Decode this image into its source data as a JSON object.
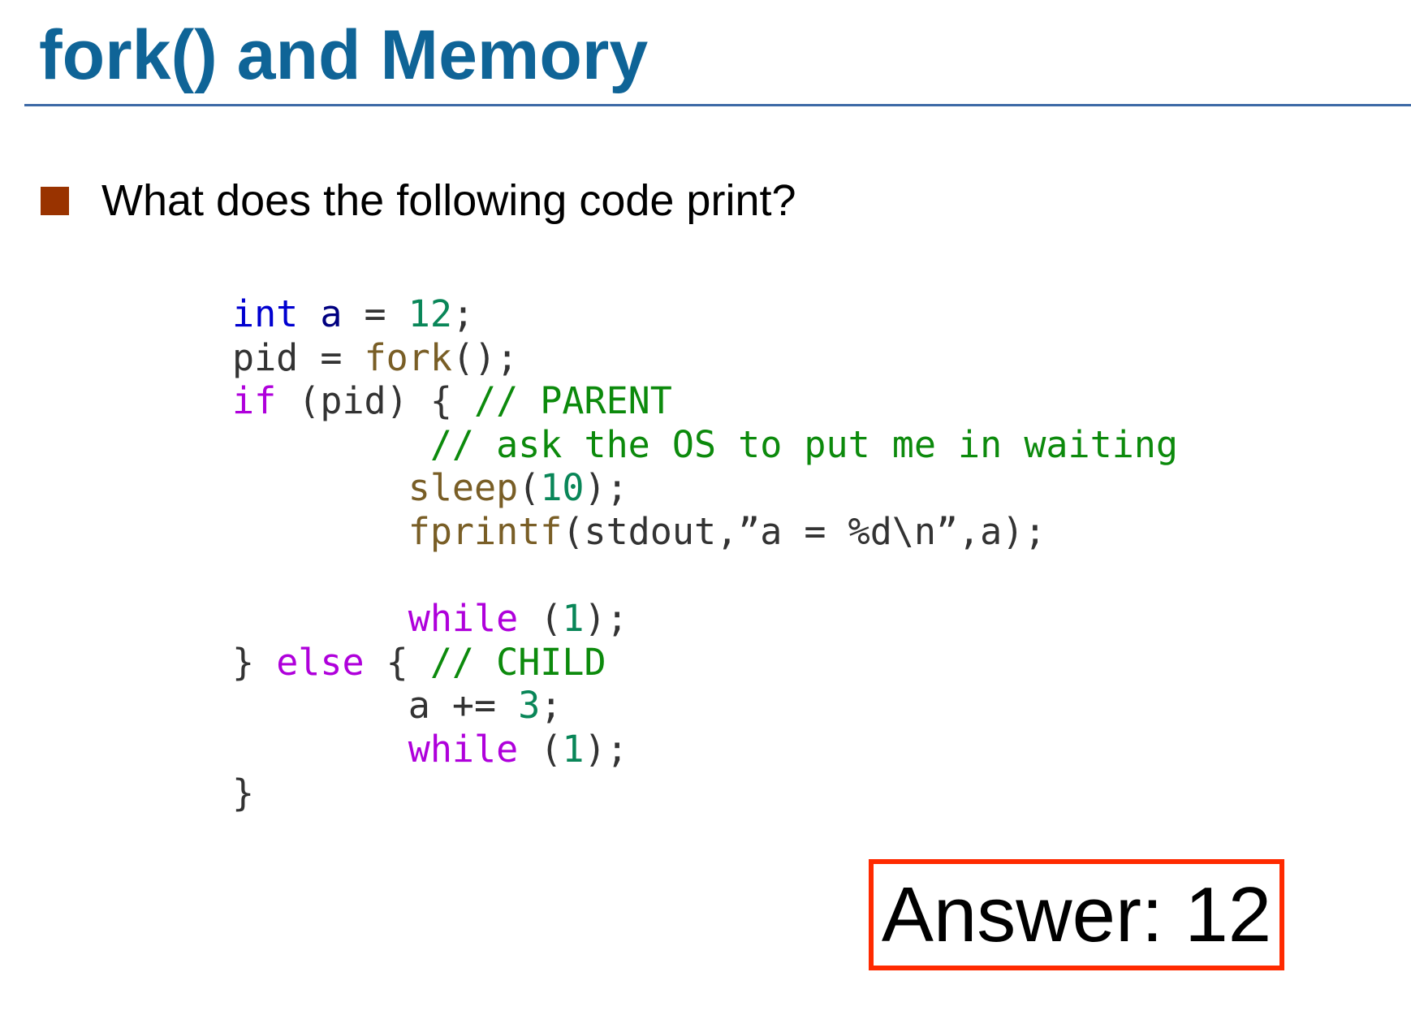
{
  "slide": {
    "title": "fork() and Memory",
    "bullet": "What does the following code print?",
    "answer": "Answer: 12"
  },
  "colors": {
    "title": "#0f6497",
    "rule": "#3d6aa6",
    "bullet_square": "#993300",
    "answer_border": "#ff2a00",
    "code_type": "#0000d0",
    "code_variable": "#000080",
    "code_number": "#098658",
    "code_function": "#795e26",
    "code_keyword": "#af00db",
    "code_comment": "#0c8a0c",
    "code_plain": "#333333"
  },
  "code": {
    "lines": [
      [
        {
          "text": "int",
          "kind": "type"
        },
        {
          "text": " ",
          "kind": "plain"
        },
        {
          "text": "a",
          "kind": "var"
        },
        {
          "text": " = ",
          "kind": "plain"
        },
        {
          "text": "12",
          "kind": "num"
        },
        {
          "text": ";",
          "kind": "plain"
        }
      ],
      [
        {
          "text": "pid = ",
          "kind": "plain"
        },
        {
          "text": "fork",
          "kind": "fn"
        },
        {
          "text": "();",
          "kind": "plain"
        }
      ],
      [
        {
          "text": "if",
          "kind": "kw"
        },
        {
          "text": " (pid) { ",
          "kind": "plain"
        },
        {
          "text": "// PARENT",
          "kind": "com"
        }
      ],
      [
        {
          "text": "        ",
          "kind": "plain"
        },
        {
          "text": " // ask the OS to put me in waiting",
          "kind": "com"
        }
      ],
      [
        {
          "text": "       ",
          "kind": "plain"
        },
        {
          "text": " sleep",
          "kind": "fn"
        },
        {
          "text": "(",
          "kind": "plain"
        },
        {
          "text": "10",
          "kind": "num"
        },
        {
          "text": ");",
          "kind": "plain"
        }
      ],
      [
        {
          "text": "       ",
          "kind": "plain"
        },
        {
          "text": " fprintf",
          "kind": "fn"
        },
        {
          "text": "(stdout,”a = %d\\n”,a);",
          "kind": "plain"
        }
      ],
      [],
      [
        {
          "text": "       ",
          "kind": "plain"
        },
        {
          "text": " while",
          "kind": "kw"
        },
        {
          "text": " (",
          "kind": "plain"
        },
        {
          "text": "1",
          "kind": "num"
        },
        {
          "text": ");",
          "kind": "plain"
        }
      ],
      [
        {
          "text": "} ",
          "kind": "plain"
        },
        {
          "text": "else",
          "kind": "kw"
        },
        {
          "text": " { ",
          "kind": "plain"
        },
        {
          "text": "// CHILD",
          "kind": "com"
        }
      ],
      [
        {
          "text": "        a += ",
          "kind": "plain"
        },
        {
          "text": "3",
          "kind": "num"
        },
        {
          "text": ";",
          "kind": "plain"
        }
      ],
      [
        {
          "text": "       ",
          "kind": "plain"
        },
        {
          "text": " while",
          "kind": "kw"
        },
        {
          "text": " (",
          "kind": "plain"
        },
        {
          "text": "1",
          "kind": "num"
        },
        {
          "text": ");",
          "kind": "plain"
        }
      ],
      [
        {
          "text": "}",
          "kind": "plain"
        }
      ]
    ]
  }
}
